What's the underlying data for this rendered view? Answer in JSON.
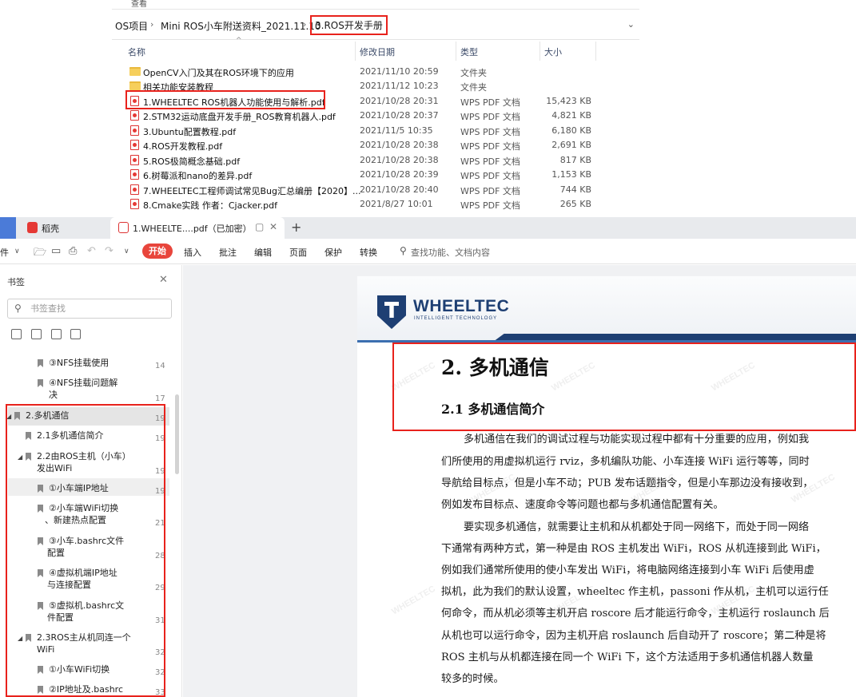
{
  "explorer": {
    "menu_hint": "查看",
    "breadcrumb": [
      "OS项目",
      "Mini ROS小车附送资料_2021.11.10",
      "3.ROS开发手册"
    ],
    "columns": {
      "name": "名称",
      "date": "修改日期",
      "type": "类型",
      "size": "大小"
    },
    "files": [
      {
        "name": "OpenCV入门及其在ROS环境下的应用",
        "date": "2021/11/10 20:59",
        "type": "文件夹",
        "size": "",
        "icon": "folder-icon"
      },
      {
        "name": "相关功能安装教程",
        "date": "2021/11/12 10:23",
        "type": "文件夹",
        "size": "",
        "icon": "folder-icon"
      },
      {
        "name": "1.WHEELTEC ROS机器人功能使用与解析.pdf",
        "date": "2021/10/28 20:31",
        "type": "WPS PDF 文档",
        "size": "15,423 KB",
        "icon": "pdf-icon"
      },
      {
        "name": "2.STM32运动底盘开发手册_ROS教育机器人.pdf",
        "date": "2021/10/28 20:37",
        "type": "WPS PDF 文档",
        "size": "4,821 KB",
        "icon": "pdf-icon"
      },
      {
        "name": "3.Ubuntu配置教程.pdf",
        "date": "2021/11/5 10:35",
        "type": "WPS PDF 文档",
        "size": "6,180 KB",
        "icon": "pdf-icon"
      },
      {
        "name": "4.ROS开发教程.pdf",
        "date": "2021/10/28 20:38",
        "type": "WPS PDF 文档",
        "size": "2,691 KB",
        "icon": "pdf-icon"
      },
      {
        "name": "5.ROS极简概念基础.pdf",
        "date": "2021/10/28 20:38",
        "type": "WPS PDF 文档",
        "size": "817 KB",
        "icon": "pdf-icon"
      },
      {
        "name": "6.树莓派和nano的差异.pdf",
        "date": "2021/10/28 20:39",
        "type": "WPS PDF 文档",
        "size": "1,153 KB",
        "icon": "pdf-icon"
      },
      {
        "name": "7.WHEELTEC工程师调试常见Bug汇总编册【2020】...",
        "date": "2021/10/28 20:40",
        "type": "WPS PDF 文档",
        "size": "744 KB",
        "icon": "pdf-icon"
      },
      {
        "name": "8.Cmake实践 作者：Cjacker.pdf",
        "date": "2021/8/27 10:01",
        "type": "WPS PDF 文档",
        "size": "265 KB",
        "icon": "pdf-icon"
      }
    ]
  },
  "tabs": {
    "inactive_label": "稻壳",
    "active_label": "1.WHEELTE....pdf（已加密）",
    "new_tab": "+"
  },
  "toolbar": {
    "file_label": "件",
    "start": "开始",
    "insert": "插入",
    "annotate": "批注",
    "edit": "编辑",
    "page": "页面",
    "protect": "保护",
    "convert": "转换",
    "search_placeholder": "查找功能、文档内容"
  },
  "bookmarks": {
    "title": "书签",
    "search_placeholder": "书签查找",
    "items": [
      {
        "label": "③NFS挂载使用",
        "page": "14"
      },
      {
        "label": "④NFS挂载问题解",
        "label2": "决",
        "page": "17"
      },
      {
        "label": "2.多机通信",
        "page": "19"
      },
      {
        "label": "2.1多机通信简介",
        "page": "19"
      },
      {
        "label": "2.2由ROS主机（小车）",
        "label2": "发出WiFi",
        "page": "19"
      },
      {
        "label": "①小车端IP地址",
        "page": "19"
      },
      {
        "label": "②小车端WiFi切换",
        "label2": "、新建热点配置",
        "page": "21"
      },
      {
        "label": "③小车.bashrc文件",
        "label2": "配置",
        "page": "28"
      },
      {
        "label": "④虚拟机端IP地址",
        "label2": "与连接配置",
        "page": "29"
      },
      {
        "label": "⑤虚拟机.bashrc文",
        "label2": "件配置",
        "page": "31"
      },
      {
        "label": "2.3ROS主从机同连一个",
        "label2": "WiFi",
        "page": "32"
      },
      {
        "label": "①小车WiFi切换",
        "page": "32"
      },
      {
        "label": "②IP地址及.bashrc",
        "page": "33"
      }
    ]
  },
  "document": {
    "brand": "WHEELTEC",
    "tagline": "INTELLIGENT TECHNOLOGY",
    "h1": "2. 多机通信",
    "h2": "2.1  多机通信简介",
    "lines": [
      "多机通信在我们的调试过程与功能实现过程中都有十分重要的应用，例如我",
      "们所使用的用虚拟机运行 rviz，多机编队功能、小车连接 WiFi 运行等等，同时",
      "导航给目标点，但是小车不动；PUB 发布话题指令，但是小车那边没有接收到，",
      "例如发布目标点、速度命令等问题也都与多机通信配置有关。",
      "要实现多机通信，就需要让主机和从机都处于同一网络下，而处于同一网络",
      "下通常有两种方式，第一种是由 ROS 主机发出 WiFi，ROS 从机连接到此 WiFi，",
      "例如我们通常所使用的使小车发出 WiFi，将电脑网络连接到小车 WiFi 后使用虚",
      "拟机，此为我们的默认设置，wheeltec 作主机，passoni 作从机，主机可以运行任",
      "何命令，而从机必须等主机开启 roscore 后才能运行命令，主机运行 roslaunch 后",
      "从机也可以运行命令，因为主机开启 roslaunch 后自动开了 roscore；第二种是将",
      "ROS 主机与从机都连接在同一个 WiFi 下，这个方法适用于多机通信机器人数量",
      "较多的时候。"
    ],
    "watermark": "WHEELTEC"
  }
}
